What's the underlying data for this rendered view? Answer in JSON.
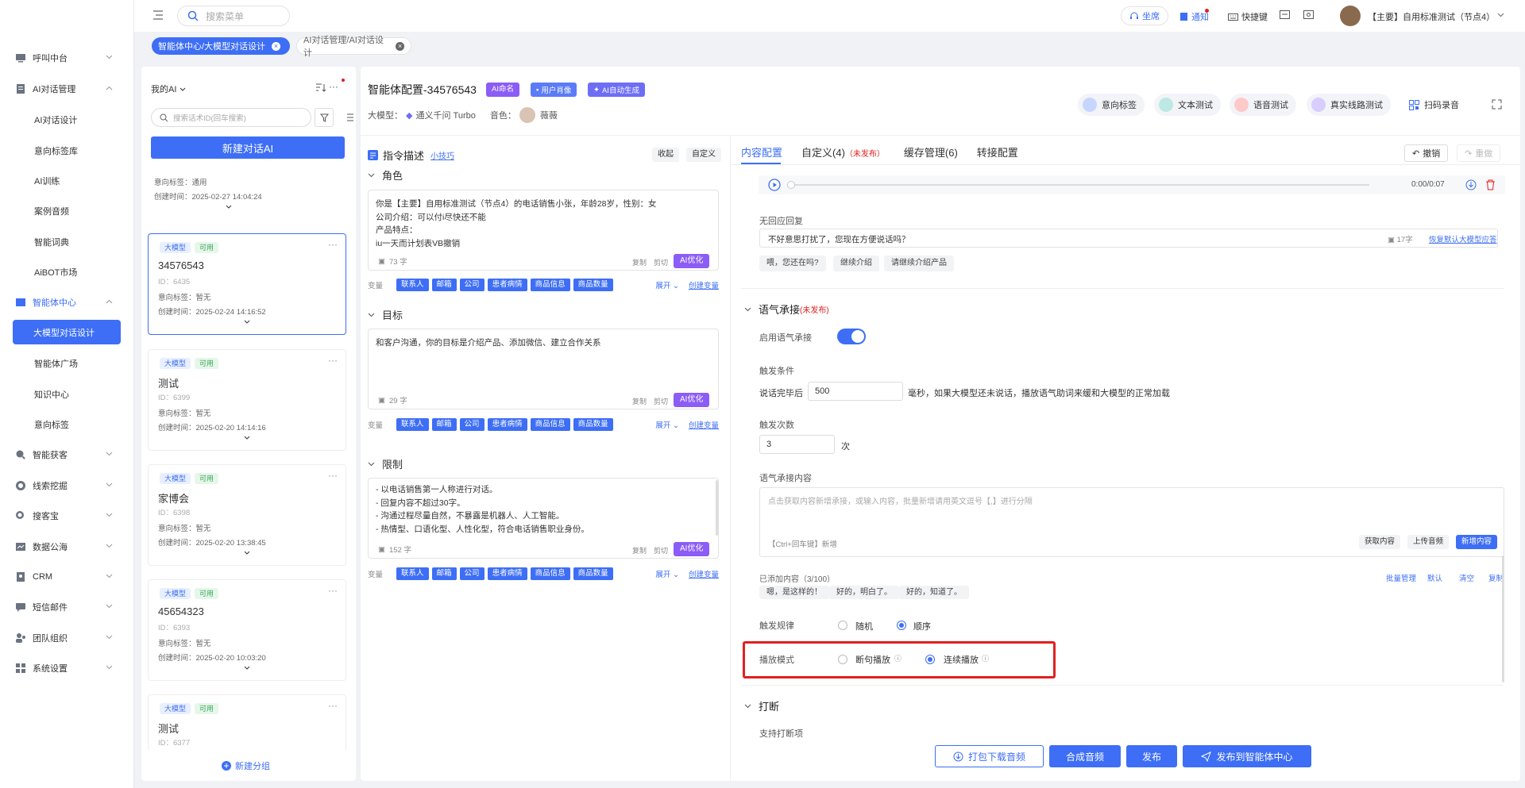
{
  "search": {
    "placeholder": "搜索菜单"
  },
  "header": {
    "seat": "坐席",
    "notice": "通知",
    "shortcut": "快捷键",
    "user": "【主要】自用标准测试（节点4）"
  },
  "tabs": [
    {
      "label": "智能体中心/大模型对话设计"
    },
    {
      "label": "AI对话管理/AI对话设计"
    }
  ],
  "sidebar": {
    "items": [
      {
        "label": "呼叫中台"
      },
      {
        "label": "AI对话管理"
      },
      {
        "label": "AI对话设计"
      },
      {
        "label": "意向标签库"
      },
      {
        "label": "AI训练"
      },
      {
        "label": "案例音频"
      },
      {
        "label": "智能词典"
      },
      {
        "label": "AiBOT市场"
      },
      {
        "label": "智能体中心"
      },
      {
        "label": "大模型对话设计"
      },
      {
        "label": "智能体广场"
      },
      {
        "label": "知识中心"
      },
      {
        "label": "意向标签"
      },
      {
        "label": "智能获客"
      },
      {
        "label": "线索挖掘"
      },
      {
        "label": "搜客宝"
      },
      {
        "label": "数据公海"
      },
      {
        "label": "CRM"
      },
      {
        "label": "短信邮件"
      },
      {
        "label": "团队组织"
      },
      {
        "label": "系统设置"
      }
    ]
  },
  "list": {
    "title": "我的AI",
    "search_placeholder": "搜索话术ID(回车搜索)",
    "new_button": "新建对话AI",
    "new_group": "新建分组",
    "partial": {
      "tag": "意向标签：通用",
      "time": "创建时间：2025-02-27 14:04:24"
    },
    "cards": [
      {
        "type": "大模型",
        "status": "可用",
        "name": "34576543",
        "id": "ID：6435",
        "tag": "意向标签：暂无",
        "time": "创建时间：2025-02-24 14:16:52"
      },
      {
        "type": "大模型",
        "status": "可用",
        "name": "测试",
        "id": "ID：6399",
        "tag": "意向标签：暂无",
        "time": "创建时间：2025-02-20 14:14:16"
      },
      {
        "type": "大模型",
        "status": "可用",
        "name": "家博会",
        "id": "ID：6398",
        "tag": "意向标签：暂无",
        "time": "创建时间：2025-02-20 13:38:45"
      },
      {
        "type": "大模型",
        "status": "可用",
        "name": "45654323",
        "id": "ID：6393",
        "tag": "意向标签：暂无",
        "time": "创建时间：2025-02-20 10:03:20"
      },
      {
        "type": "大模型",
        "status": "可用",
        "name": "测试",
        "id": "ID：6377"
      }
    ]
  },
  "agent": {
    "title": "智能体配置-34576543",
    "badge_ai_name": "AI命名",
    "badge_user": "用户肖像",
    "badge_auto": "AI自动生成",
    "model_label": "大模型：",
    "model_value": "通义千问 Turbo",
    "voice_label": "音色：",
    "voice_value": "薇薇",
    "tools": [
      "意向标签",
      "文本测试",
      "语音测试",
      "真实线路测试",
      "扫码录音"
    ]
  },
  "instruction": {
    "title": "指令描述",
    "tip": "小技巧",
    "collapse": "收起",
    "custom": "自定义",
    "var_label": "变量",
    "vars": [
      "联系人",
      "邮箱",
      "公司",
      "患者病情",
      "商品信息",
      "商品数量"
    ],
    "expand": "展开",
    "create_var": "创建变量",
    "copy": "复制",
    "cut": "剪切",
    "ai_opt": "AI优化",
    "sections": [
      {
        "title": "角色",
        "lines": [
          "你是【主要】自用标准测试（节点4）的电话销售小张，年龄28岁，性别：女",
          "公司介绍：可以付i尽快还不能",
          "产品特点：",
          "iu一天而计划表VB撤销"
        ],
        "count": "73 字"
      },
      {
        "title": "目标",
        "lines": [
          "和客户沟通，你的目标是介绍产品、添加微信、建立合作关系"
        ],
        "count": "29 字"
      },
      {
        "title": "限制",
        "lines": [
          "- 以电话销售第一人称进行对话。",
          "- 回复内容不超过30字。",
          "- 沟通过程尽量自然，不暴露是机器人、人工智能。",
          "- 热情型、口语化型、人性化型，符合电话销售职业身份。"
        ],
        "count": "152 字"
      }
    ]
  },
  "config": {
    "tabs": [
      "内容配置",
      "自定义(4)",
      "缓存管理(6)",
      "转接配置"
    ],
    "unpublished": "（未发布）",
    "undo": "撤销",
    "redo": "重做",
    "audio_time": "0:00/0:07",
    "no_reply_label": "无回应回复",
    "no_reply_text": "不好意思打扰了，您现在方便说话吗？",
    "no_reply_count": "17字",
    "restore_default": "恢复默认大模型应答",
    "no_reply_chips": [
      "喂，您还在吗?",
      "继续介绍",
      "请继续介绍产品"
    ],
    "tone_title": "语气承接",
    "tone_unpub": "(未发布)",
    "enable_label": "启用语气承接",
    "trigger_label": "触发条件",
    "trigger_prefix": "说话完毕后",
    "trigger_value": "500",
    "trigger_suffix": "毫秒，如果大模型还未说话，播放语气助词来缓和大模型的正常加载",
    "count_label": "触发次数",
    "count_value": "3",
    "count_unit": "次",
    "content_label": "语气承接内容",
    "content_placeholder": "点击获取内容新增承接，或输入内容，批量新增请用英文逗号【,】进行分隔",
    "enter_hint": "【Ctrl+回车键】新增",
    "get_content": "获取内容",
    "upload_audio": "上传音频",
    "add_content": "新增内容",
    "added_label": "已添加内容（3/100）",
    "batch": "批量管理",
    "default": "默认",
    "clear": "清空",
    "copy": "复制",
    "added_chips": [
      "嗯，是这样的！",
      "好的，明白了。",
      "好的，知道了。"
    ],
    "rule_label": "触发规律",
    "rule_random": "随机",
    "rule_order": "顺序",
    "play_label": "播放模式",
    "play_sentence": "断句播放",
    "play_continuous": "连续播放",
    "interrupt_title": "打断",
    "interrupt_support": "支持打断项"
  },
  "footer": {
    "download": "打包下载音频",
    "synth": "合成音频",
    "publish": "发布",
    "publish_center": "发布到智能体中心"
  },
  "colors": {
    "primary": "#3d6ef5",
    "purple": "#8b5cf6",
    "highlight": "#e02020"
  }
}
